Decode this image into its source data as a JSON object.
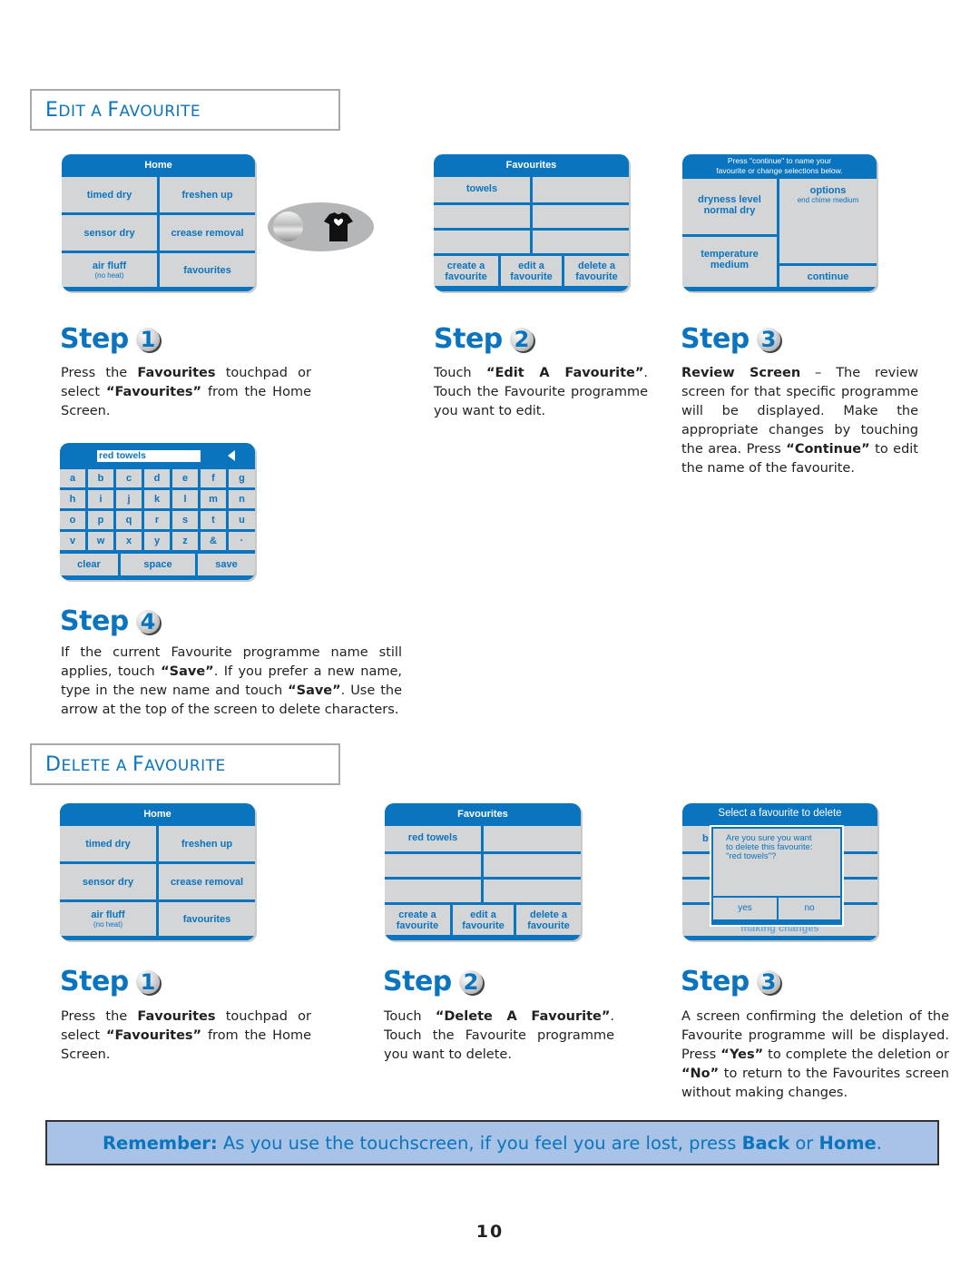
{
  "edit_section": {
    "title_first": "E",
    "title_rest": "DIT A ",
    "title_first2": "F",
    "title_rest2": "AVOURITE",
    "home_screen": {
      "header": "Home",
      "buttons": [
        {
          "label": "timed dry"
        },
        {
          "label": "freshen up"
        },
        {
          "label": "sensor dry"
        },
        {
          "label": "crease removal"
        },
        {
          "label": "air fluff",
          "sub": "(no heat)"
        },
        {
          "label": "favourites"
        }
      ]
    },
    "favourites_screen": {
      "header": "Favourites",
      "items": [
        "towels",
        "",
        "",
        "",
        "",
        ""
      ],
      "actions": [
        {
          "line1": "create a",
          "line2": "favourite"
        },
        {
          "line1": "edit a",
          "line2": "favourite"
        },
        {
          "line1": "delete a",
          "line2": "favourite"
        }
      ]
    },
    "review_screen": {
      "header_line1": "Press \"continue\" to name your",
      "header_line2": "favourite or change selections below.",
      "dryness_label": "dryness level",
      "dryness_value": "normal dry",
      "options_label": "options",
      "options_value": "end chime medium",
      "temperature_label": "temperature",
      "temperature_value": "medium",
      "continue_label": "continue"
    },
    "keyboard_screen": {
      "input_value": "red towels",
      "keys": [
        [
          "a",
          "b",
          "c",
          "d",
          "e",
          "f",
          "g"
        ],
        [
          "h",
          "i",
          "j",
          "k",
          "l",
          "m",
          "n"
        ],
        [
          "o",
          "p",
          "q",
          "r",
          "s",
          "t",
          "u"
        ],
        [
          "v",
          "w",
          "x",
          "y",
          "z",
          "&",
          "·"
        ]
      ],
      "clear": "clear",
      "space": "space",
      "save": "save"
    },
    "steps": [
      {
        "word": "Step",
        "num": "1"
      },
      {
        "word": "Step",
        "num": "2"
      },
      {
        "word": "Step",
        "num": "3"
      },
      {
        "word": "Step",
        "num": "4"
      }
    ],
    "step1_text": {
      "a": "Press the ",
      "b": "Favourites",
      "c": " touchpad or select ",
      "d": "“Favourites”",
      "e": " from the Home Screen."
    },
    "step2_text": {
      "a": "Touch ",
      "b": "“Edit A Favourite”",
      "c": ". Touch the Favourite programme you want to edit."
    },
    "step3_text": {
      "a": "Review Screen",
      "b": " – The review screen for that specific programme will be displayed.  Make the appropriate changes by touching the area. Press ",
      "c": "“Continue”",
      "d": " to edit the name of the favourite."
    },
    "step4_text": {
      "a": "If the current Favourite programme name still applies, touch ",
      "b": "“Save”",
      "c": ".  If you prefer a new name, type in the new name and touch ",
      "d": "“Save”",
      "e": ".  Use the arrow at the top of the screen to delete characters."
    }
  },
  "delete_section": {
    "title_first": "D",
    "title_rest": "ELETE A ",
    "title_first2": "F",
    "title_rest2": "AVOURITE",
    "home_screen": {
      "header": "Home",
      "buttons": [
        {
          "label": "timed dry"
        },
        {
          "label": "freshen up"
        },
        {
          "label": "sensor dry"
        },
        {
          "label": "crease removal"
        },
        {
          "label": "air fluff",
          "sub": "(no heat)"
        },
        {
          "label": "favourites"
        }
      ]
    },
    "favourites_screen": {
      "header": "Favourites",
      "items": [
        "red towels",
        "",
        "",
        "",
        "",
        ""
      ],
      "actions": [
        {
          "line1": "create a",
          "line2": "favourite"
        },
        {
          "line1": "edit a",
          "line2": "favourite"
        },
        {
          "line1": "delete a",
          "line2": "favourite"
        }
      ]
    },
    "confirm_screen": {
      "header": "Select a favourite to delete",
      "behind_letter": "b",
      "behind_text": "making changes",
      "dialog_line1": "Are you sure you want",
      "dialog_line2": "to delete this favourite:",
      "dialog_line3": "\"red towels\"?",
      "yes": "yes",
      "no": "no"
    },
    "steps": [
      {
        "word": "Step",
        "num": "1"
      },
      {
        "word": "Step",
        "num": "2"
      },
      {
        "word": "Step",
        "num": "3"
      }
    ],
    "step1_text": {
      "a": "Press the ",
      "b": "Favourites",
      "c": " touchpad or select ",
      "d": "“Favourites”",
      "e": " from the Home Screen."
    },
    "step2_text": {
      "a": "Touch ",
      "b": "“Delete A Favourite”",
      "c": ". Touch the Favourite programme you want to delete."
    },
    "step3_text": {
      "a": "A screen confirming the deletion of the Favourite programme will be displayed. Press ",
      "b": "“Yes”",
      "c": " to complete the deletion or ",
      "d": "“No”",
      "e": " to return to the Favourites screen without making changes."
    }
  },
  "touchpad_icons": {
    "left": "round-button-icon",
    "right": "shirt-heart-icon"
  },
  "remember": {
    "label": "Remember:",
    "text": "  As you use the touchscreen, if you feel you are lost, press ",
    "back": "Back",
    "or": " or ",
    "home": "Home",
    "end": "."
  },
  "page_number": "10",
  "colors": {
    "brand_blue": "#0b74bf",
    "panel_grey": "#d4d5d6",
    "remember_bg": "#a9c3e6"
  }
}
